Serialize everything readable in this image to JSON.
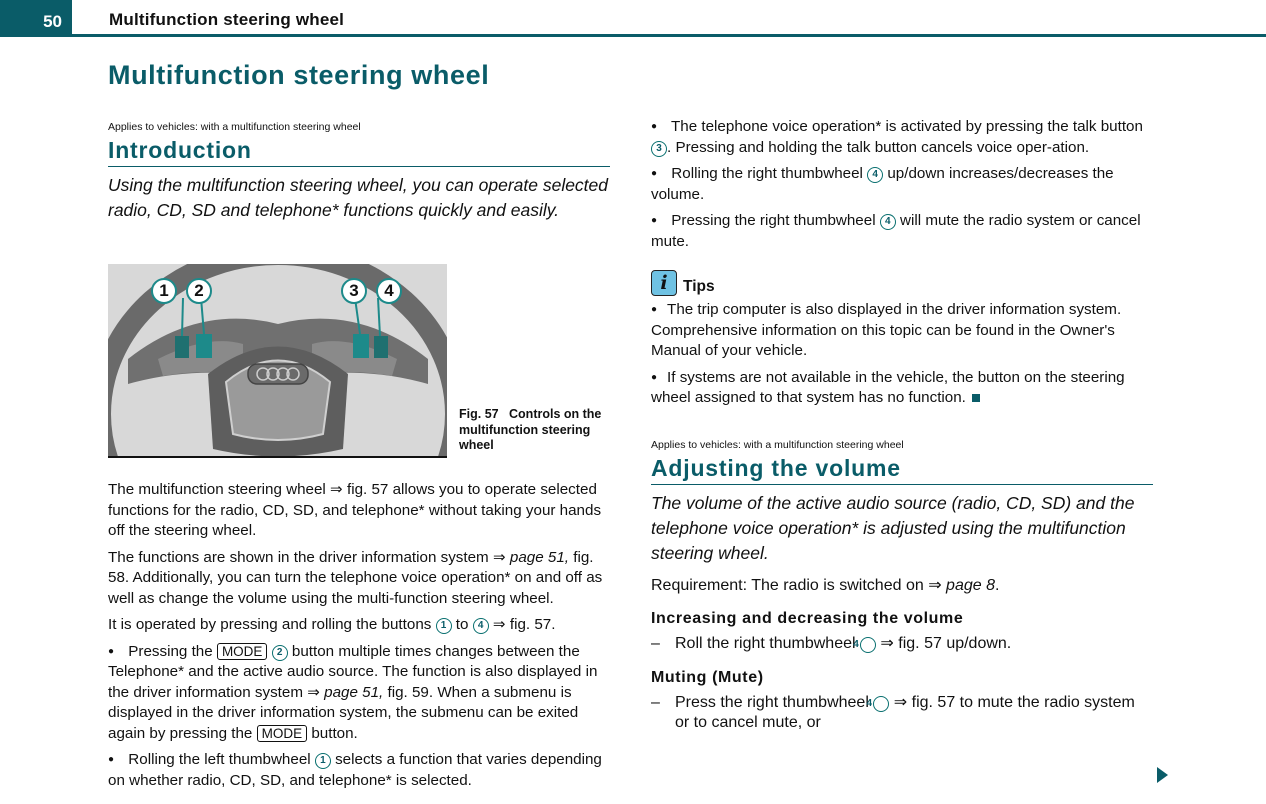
{
  "header": {
    "page_number": "50",
    "running_title": "Multifunction steering wheel"
  },
  "page_title": "Multifunction steering wheel",
  "intro": {
    "applies": "Applies to vehicles: with a multifunction steering wheel",
    "heading": "Introduction",
    "lead": "Using the multifunction steering wheel, you can operate selected radio, CD, SD and telephone* functions quickly and easily.",
    "figure": {
      "callouts": [
        "1",
        "2",
        "3",
        "4"
      ],
      "caption_fig": "Fig. 57",
      "caption_text": "Controls on the multifunction steering wheel"
    },
    "p1": {
      "a": "The multifunction steering wheel ",
      "ref": "⇒ fig. 57",
      "b": " allows you to operate selected functions for the radio, CD, SD, and telephone* without taking your hands off the steering wheel."
    },
    "p2": {
      "a": "The functions are shown in the driver information system ",
      "arrow": "⇒ ",
      "page_ref": "page 51,",
      "b": " fig. 58. Additionally, you can turn the telephone voice operation* on and off as well as change the volume using the multi-function steering wheel."
    },
    "p3": {
      "a": "It is operated by pressing and rolling the buttons ",
      "n1": "1",
      "mid": " to ",
      "n2": "4",
      "b": " ⇒ fig. 57."
    },
    "b1": {
      "a": "Pressing the ",
      "key": "MODE",
      "n": "2",
      "b": " button multiple times changes between the Telephone* and the active audio source. The function is also displayed in the driver information system ",
      "arrow": "⇒ ",
      "page_ref": "page 51,",
      "c": " fig. 59. When a submenu is displayed in the driver information system, the submenu can be exited again by pressing the ",
      "key2": "MODE",
      "d": " button."
    },
    "b2": {
      "a": "Rolling the left thumbwheel ",
      "n": "1",
      "b": " selects a function that varies depending on whether radio, CD, SD, and telephone* is selected."
    }
  },
  "right": {
    "b3": {
      "a": "The telephone voice operation* is activated by pressing the talk button ",
      "n": "3",
      "b": ". Pressing and holding the talk button cancels voice oper-ation."
    },
    "b4": {
      "a": "Rolling the right thumbwheel ",
      "n": "4",
      "b": " up/down increases/decreases the volume."
    },
    "b5": {
      "a": "Pressing the right thumbwheel ",
      "n": "4",
      "b": " will mute the radio system or cancel mute."
    },
    "tips": {
      "label": "Tips",
      "icon": "info-icon",
      "t1": "The trip computer is also displayed in the driver information system. Comprehensive information on this topic can be found in the Owner's Manual of your vehicle.",
      "t2": "If systems are not available in the vehicle, the button on the steering wheel assigned to that system has no function."
    },
    "volume": {
      "applies": "Applies to vehicles: with a multifunction steering wheel",
      "heading": "Adjusting the volume",
      "lead": "The volume of the active audio source (radio, CD, SD) and the telephone voice operation* is adjusted using the multifunction steering wheel.",
      "req_a": "Requirement: The radio is switched on ",
      "req_arrow": "⇒ ",
      "req_page": "page 8",
      "req_b": ".",
      "sub1": "Increasing and decreasing the volume",
      "step1": {
        "dash": "–",
        "a": "Roll the right thumbwheel ",
        "n": "4",
        "b": " ⇒ fig. 57 up/down."
      },
      "sub2": "Muting (Mute)",
      "step2": {
        "dash": "–",
        "a": "Press the right thumbwheel ",
        "n": "4",
        "b": " ⇒ fig. 57 to mute the radio system or to cancel mute, or"
      }
    }
  },
  "colors": {
    "brand_teal": "#0a5c68",
    "info_blue": "#6fc2e3"
  }
}
